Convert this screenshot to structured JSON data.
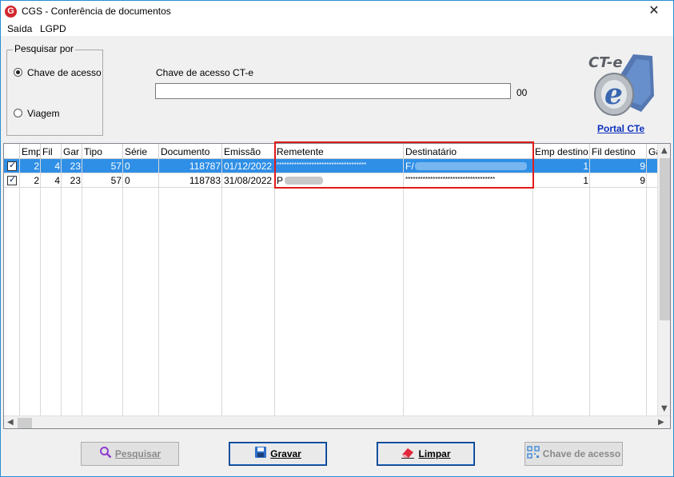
{
  "window": {
    "title": "CGS - Conferência de documentos",
    "close_glyph": "✕",
    "logo_letter": "G"
  },
  "menu": {
    "items": [
      "Saída",
      "LGPD"
    ]
  },
  "search": {
    "group_label": "Pesquisar por",
    "options": [
      {
        "label": "Chave de acesso",
        "selected": true
      },
      {
        "label": "Viagem",
        "selected": false
      }
    ],
    "field_label": "Chave de acesso CT-e",
    "field_value": "",
    "field_suffix": "00"
  },
  "portal": {
    "link_text": "Portal CTe",
    "logo_text": "CT-e"
  },
  "grid": {
    "columns": [
      "",
      "Emp",
      "Fil",
      "Gar",
      "Tipo",
      "Série",
      "Documento",
      "Emissão",
      "Remetente",
      "Destinatário",
      "Emp destino",
      "Fil destino",
      "Ga"
    ],
    "rows": [
      {
        "checked": true,
        "selected": true,
        "emp": "2",
        "fil": "4",
        "gar": "23",
        "tipo": "57",
        "serie": "0",
        "documento": "118787",
        "emissao": "01/12/2022",
        "remetente": "************************************",
        "destinatario": "F/",
        "emp_destino": "1",
        "fil_destino": "9"
      },
      {
        "checked": true,
        "selected": false,
        "emp": "2",
        "fil": "4",
        "gar": "23",
        "tipo": "57",
        "serie": "0",
        "documento": "118783",
        "emissao": "31/08/2022",
        "remetente": "P",
        "destinatario": "************************************",
        "emp_destino": "1",
        "fil_destino": "9"
      }
    ]
  },
  "buttons": {
    "pesquisar": {
      "label": "Pesquisar",
      "enabled": false
    },
    "gravar": {
      "label": "Gravar",
      "enabled": true
    },
    "limpar": {
      "label": "Limpar",
      "enabled": true
    },
    "chave": {
      "label": "Chave de acesso",
      "enabled": false
    }
  },
  "colors": {
    "selection": "#2f8fe6",
    "highlight": "#e01b1b",
    "link": "#0a2fbd",
    "window_border": "#2a8dd4"
  }
}
